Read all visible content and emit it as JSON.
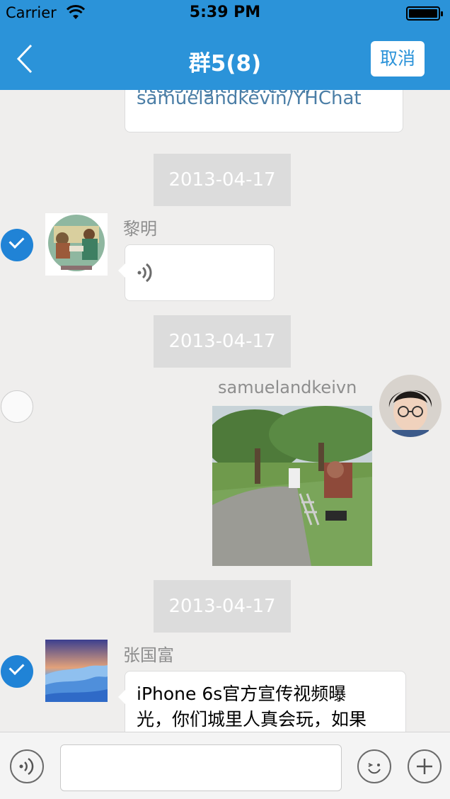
{
  "status": {
    "carrier": "Carrier",
    "time": "5:39 PM"
  },
  "nav": {
    "title": "群5(8)",
    "cancel_label": "取消"
  },
  "messages": {
    "link": {
      "line1": "https://github.com/",
      "line2": "samuelandkevin/YHChat"
    },
    "date1": "2013-04-17",
    "voice_msg": {
      "sender": "黎明"
    },
    "date2": "2013-04-17",
    "photo_msg": {
      "sender": "samuelandkeivn"
    },
    "date3": "2013-04-17",
    "text_msg": {
      "sender": "张国富",
      "line1": "iPhone 6s官方宣传视频曝",
      "line2": "光，你们城里人真会玩，如果"
    }
  },
  "input": {
    "placeholder": "",
    "value": ""
  },
  "icons": {
    "back": "chevron-left-icon",
    "voice": "voice-wave-icon",
    "emoji": "emoji-icon",
    "add": "plus-icon",
    "check": "checkmark-icon"
  },
  "colors": {
    "nav_bg": "#2b93d9",
    "check_on": "#2083d6",
    "link_text": "#4b7ea6",
    "chat_bg": "#efeeed"
  }
}
